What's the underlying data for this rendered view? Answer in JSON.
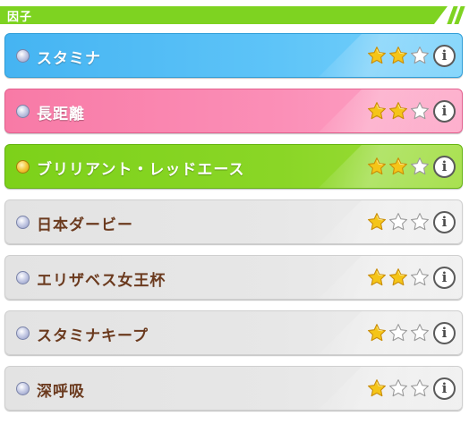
{
  "header": {
    "title": "因子"
  },
  "factors": [
    {
      "name": "スタミナ",
      "stars": 2,
      "max_stars": 3,
      "color": "blue",
      "bullet": "silver"
    },
    {
      "name": "長距離",
      "stars": 2,
      "max_stars": 3,
      "color": "pink",
      "bullet": "silver"
    },
    {
      "name": "ブリリアント・レッドエース",
      "stars": 2,
      "max_stars": 3,
      "color": "green",
      "bullet": "gold"
    },
    {
      "name": "日本ダービー",
      "stars": 1,
      "max_stars": 3,
      "color": "gray",
      "bullet": "silver"
    },
    {
      "name": "エリザベス女王杯",
      "stars": 2,
      "max_stars": 3,
      "color": "gray",
      "bullet": "silver"
    },
    {
      "name": "スタミナキープ",
      "stars": 1,
      "max_stars": 3,
      "color": "gray",
      "bullet": "silver"
    },
    {
      "name": "深呼吸",
      "stars": 1,
      "max_stars": 3,
      "color": "gray",
      "bullet": "silver"
    }
  ],
  "icons": {
    "star": "star-icon",
    "info": "info-icon",
    "bullet": "bullet-icon"
  },
  "colors": {
    "header": "#7ed321",
    "blue": "#45b4f2",
    "pink": "#f87aa6",
    "green": "#7dd11a",
    "gray": "#e3e3e3",
    "star_filled": "#f5c518",
    "star_empty": "#ffffff",
    "dark_text": "#6b3a1e"
  },
  "info_glyph": "i"
}
